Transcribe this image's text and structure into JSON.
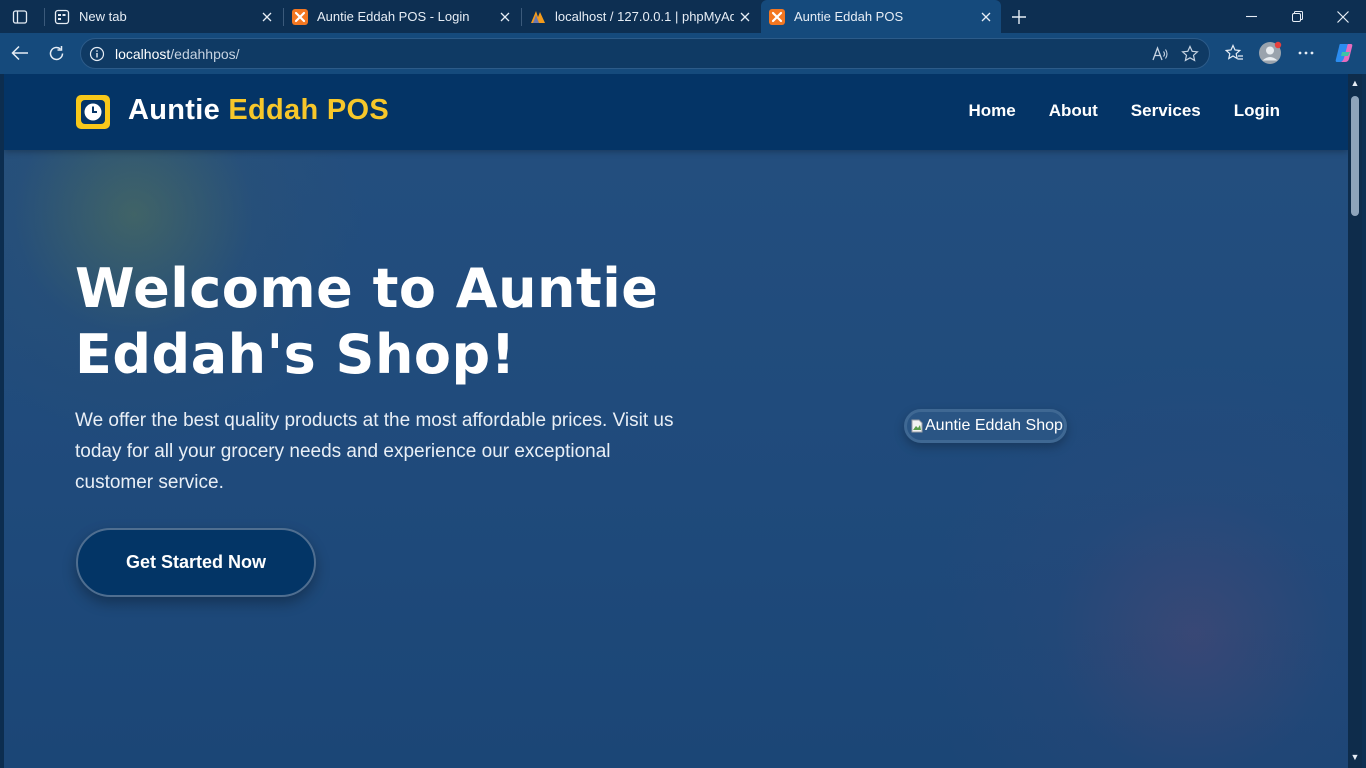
{
  "browser": {
    "tabs": [
      {
        "title": "New tab",
        "icon": "new-tab-icon",
        "active": false
      },
      {
        "title": "Auntie Eddah POS - Login",
        "icon": "xampp-icon",
        "active": false
      },
      {
        "title": "localhost / 127.0.0.1 | phpMyAdm",
        "icon": "phpmyadmin-icon",
        "active": false
      },
      {
        "title": "Auntie Eddah POS",
        "icon": "xampp-icon",
        "active": true
      }
    ],
    "address": {
      "host": "localhost",
      "path": "/edahhpos/"
    }
  },
  "site": {
    "brand": {
      "name_part1": "Auntie ",
      "name_part2": "Eddah POS"
    },
    "nav": [
      "Home",
      "About",
      "Services",
      "Login"
    ],
    "hero": {
      "title": "Welcome to Auntie Eddah's Shop!",
      "text": "We offer the best quality products at the most affordable prices. Visit us today for all your grocery needs and experience our exceptional customer service.",
      "cta": "Get Started Now",
      "image_alt": "Auntie Eddah Shop"
    }
  },
  "colors": {
    "accent": "#f7c72a",
    "header": "#043466",
    "page_bg": "#1f4a7b"
  }
}
